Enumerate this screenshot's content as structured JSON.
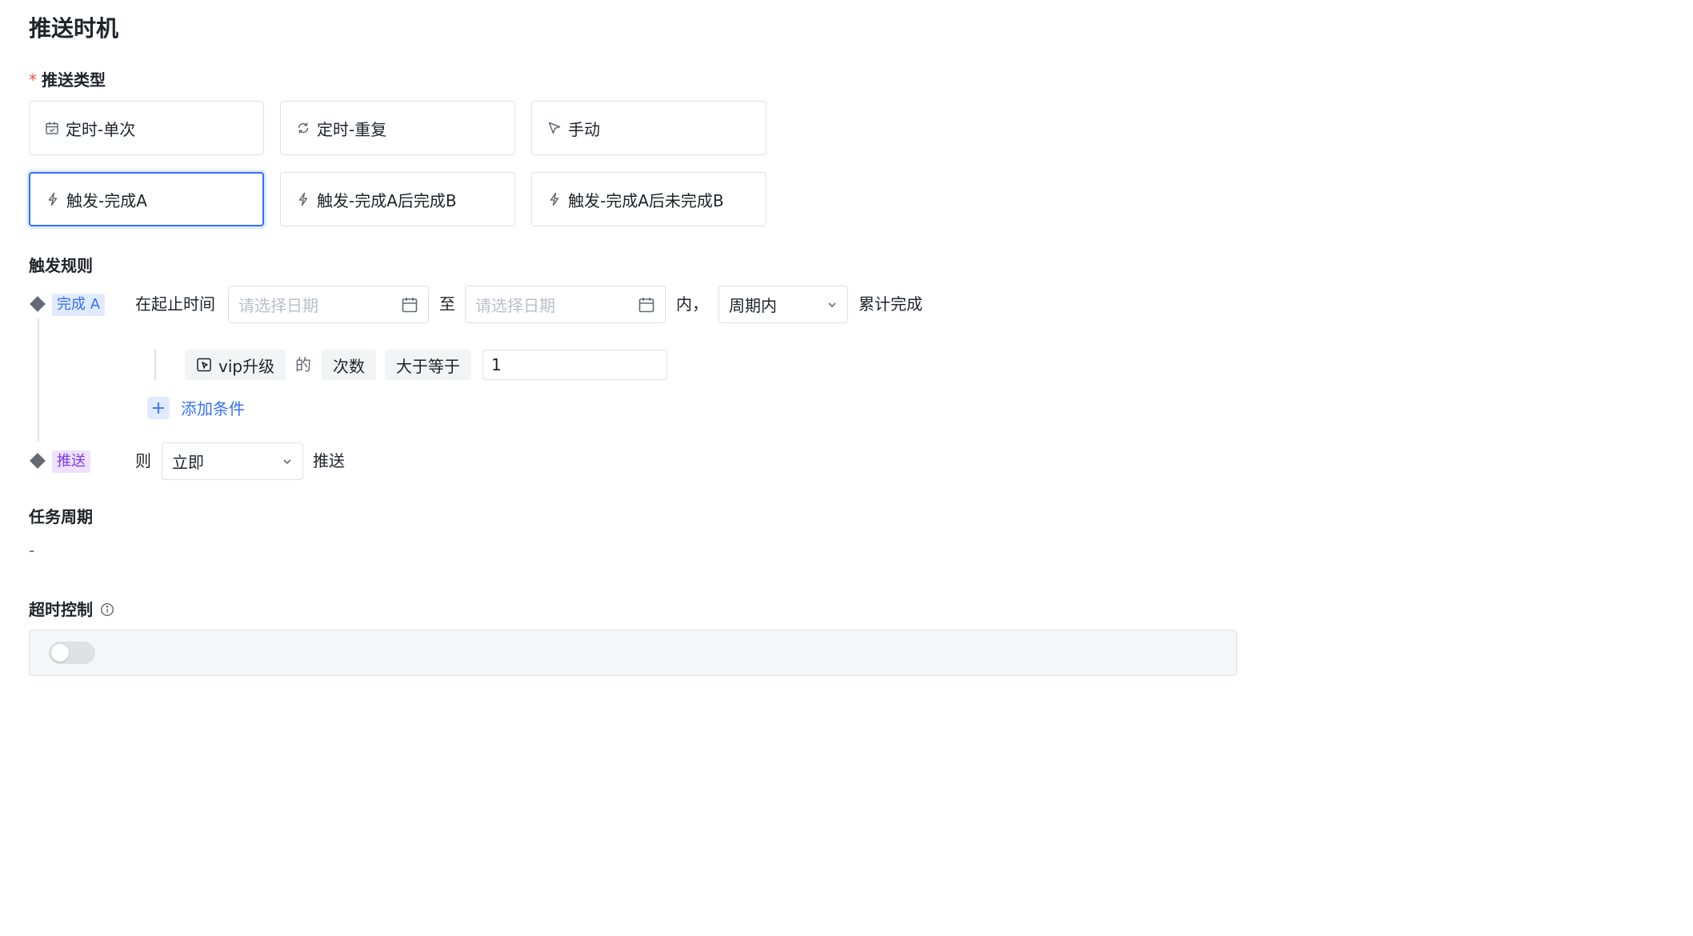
{
  "page_title": "推送时机",
  "push_type": {
    "label": "推送类型",
    "required_mark": "*",
    "options": [
      {
        "label": "定时-单次",
        "icon": "calendar-icon",
        "selected": false
      },
      {
        "label": "定时-重复",
        "icon": "refresh-icon",
        "selected": false
      },
      {
        "label": "手动",
        "icon": "cursor-icon",
        "selected": false
      },
      {
        "label": "触发-完成A",
        "icon": "lightning-icon",
        "selected": true
      },
      {
        "label": "触发-完成A后完成B",
        "icon": "lightning-icon",
        "selected": false
      },
      {
        "label": "触发-完成A后未完成B",
        "icon": "lightning-icon",
        "selected": false
      }
    ]
  },
  "trigger_rules": {
    "label": "触发规则",
    "step_a": {
      "tag": "完成 A",
      "prefix": "在起止时间",
      "start_date_placeholder": "请选择日期",
      "to_text": "至",
      "end_date_placeholder": "请选择日期",
      "within_text": "内，",
      "period_select": "周期内",
      "suffix": "累计完成"
    },
    "condition": {
      "event": "vip升级",
      "of_text": "的",
      "metric": "次数",
      "operator": "大于等于",
      "value": "1"
    },
    "add_condition_label": "添加条件",
    "push_step": {
      "tag": "推送",
      "then_text": "则",
      "timing_select": "立即",
      "suffix": "推送"
    }
  },
  "task_cycle": {
    "label": "任务周期",
    "value": "-"
  },
  "timeout_control": {
    "label": "超时控制",
    "enabled": false
  },
  "colors": {
    "accent": "#3370ff",
    "border": "#dee0e3",
    "purple_tag": "#7f3bf5",
    "required": "#f54a45"
  }
}
